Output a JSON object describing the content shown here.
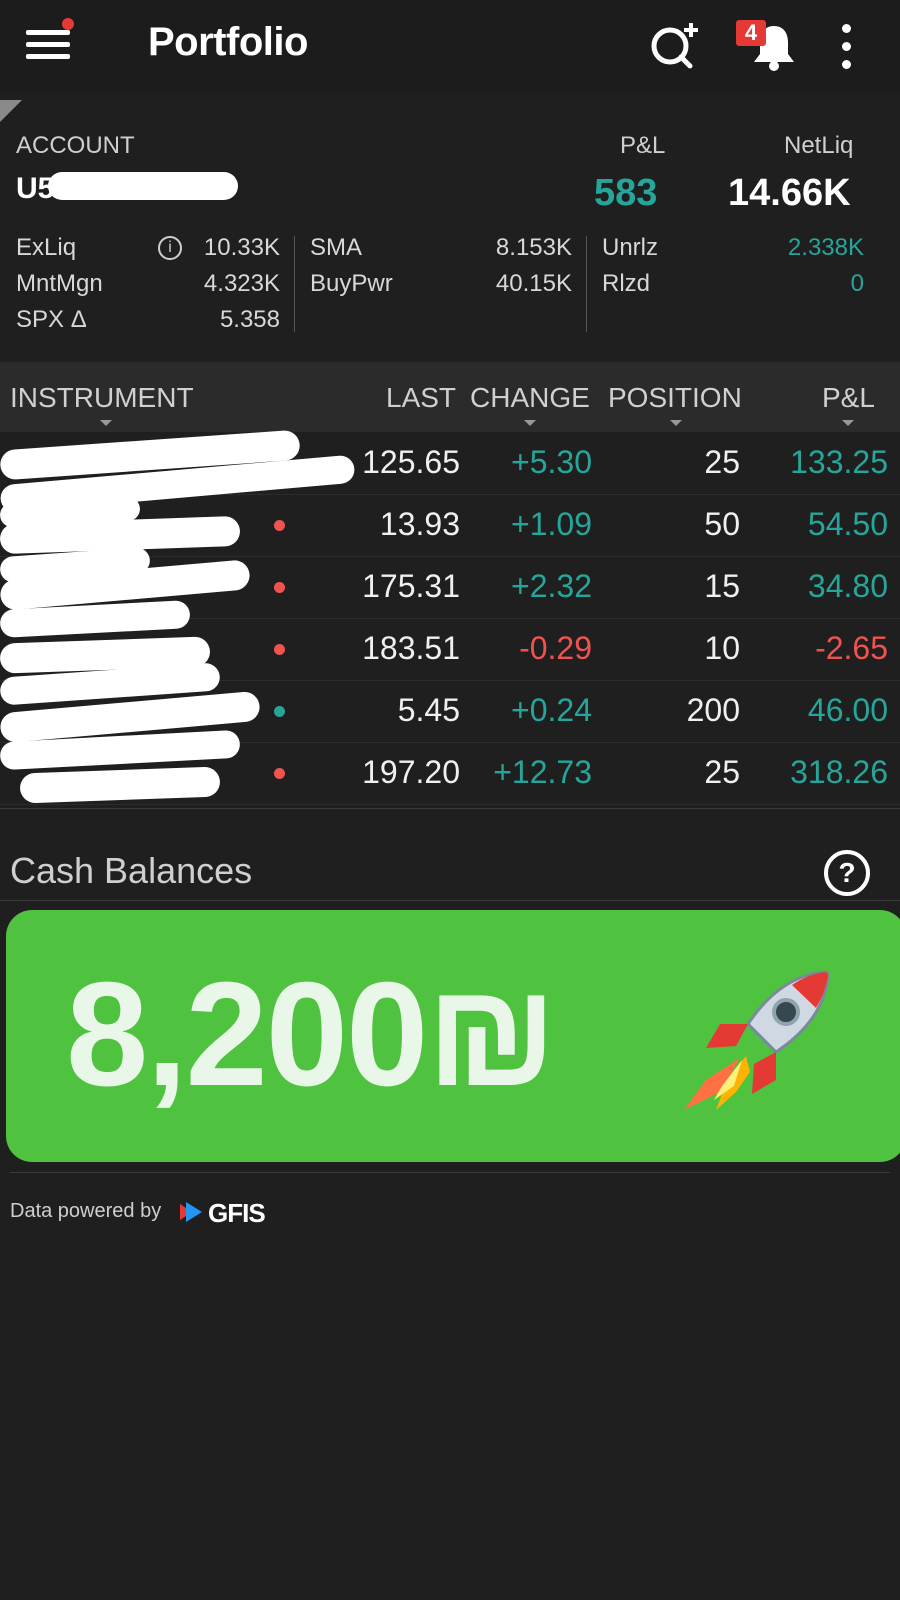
{
  "header": {
    "title": "Portfolio",
    "notification_count": "4"
  },
  "account": {
    "label": "ACCOUNT",
    "id_prefix": "U5",
    "pl_label": "P&L",
    "pl_value": "583",
    "netliq_label": "NetLiq",
    "netliq_value": "14.66K"
  },
  "metrics": {
    "exliq_label": "ExLiq",
    "exliq_value": "10.33K",
    "mntmgn_label": "MntMgn",
    "mntmgn_value": "4.323K",
    "spx_label": "SPX Δ",
    "spx_value": "5.358",
    "sma_label": "SMA",
    "sma_value": "8.153K",
    "buypwr_label": "BuyPwr",
    "buypwr_value": "40.15K",
    "unrlz_label": "Unrlz",
    "unrlz_value": "2.338K",
    "rlzd_label": "Rlzd",
    "rlzd_value": "0"
  },
  "table": {
    "headers": {
      "instrument": "INSTRUMENT",
      "last": "LAST",
      "change": "CHANGE",
      "position": "POSITION",
      "pl": "P&L"
    },
    "rows": [
      {
        "last": "125.65",
        "change": "+5.30",
        "position": "25",
        "pl": "133.25",
        "dir": "up",
        "dot": "teal"
      },
      {
        "last": "13.93",
        "change": "+1.09",
        "position": "50",
        "pl": "54.50",
        "dir": "up",
        "dot": "red"
      },
      {
        "last": "175.31",
        "change": "+2.32",
        "position": "15",
        "pl": "34.80",
        "dir": "up",
        "dot": "red"
      },
      {
        "last": "183.51",
        "change": "-0.29",
        "position": "10",
        "pl": "-2.65",
        "dir": "down",
        "dot": "red"
      },
      {
        "last": "5.45",
        "change": "+0.24",
        "position": "200",
        "pl": "46.00",
        "dir": "up",
        "dot": "teal"
      },
      {
        "last": "197.20",
        "change": "+12.73",
        "position": "25",
        "pl": "318.26",
        "dir": "up",
        "dot": "red"
      }
    ]
  },
  "cash": {
    "title": "Cash Balances",
    "help_glyph": "?",
    "amount": "8,200₪"
  },
  "footer": {
    "powered_by": "Data powered by",
    "brand": "GFIS"
  },
  "colors": {
    "background": "#1f1f1f",
    "positive": "#26a69a",
    "negative": "#ef5350",
    "badge": "#e53935",
    "card_green": "#4fc23f"
  }
}
